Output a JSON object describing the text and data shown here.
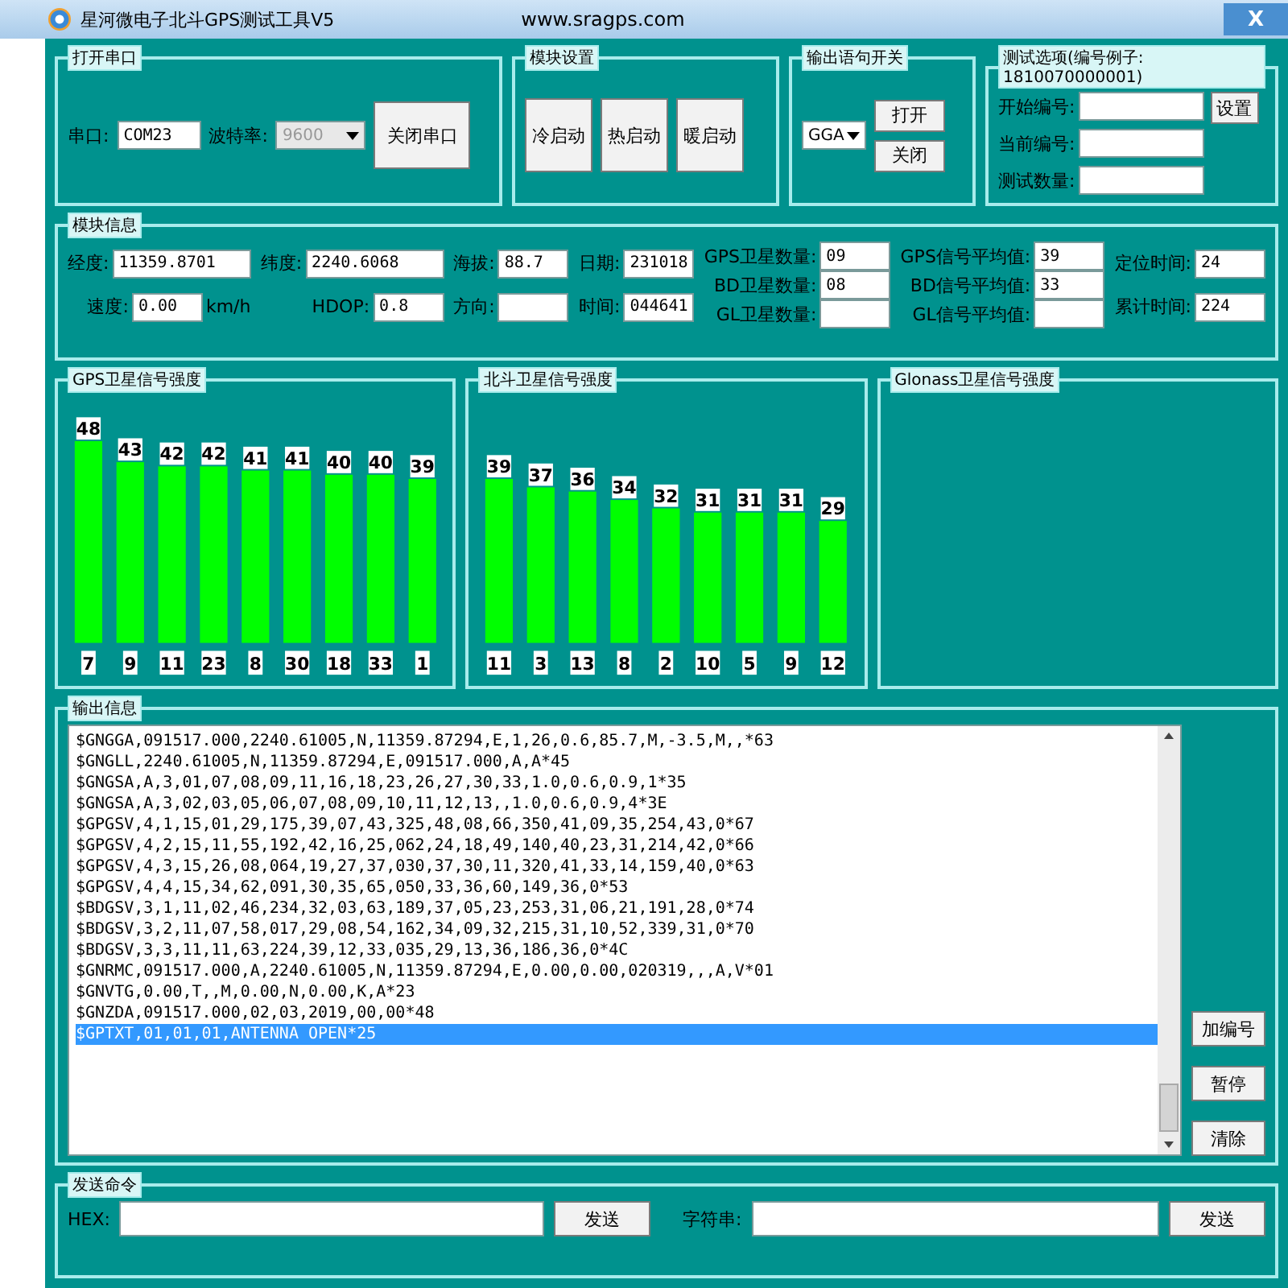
{
  "window": {
    "title": "星河微电子北斗GPS测试工具V5",
    "url": "www.sragps.com",
    "close": "X"
  },
  "serial": {
    "title": "打开串口",
    "port_label": "串口:",
    "port": "COM23",
    "baud_label": "波特率:",
    "baud": "9600",
    "baud_disabled": true,
    "button": "关闭串口"
  },
  "module_settings": {
    "title": "模块设置",
    "buttons": [
      "冷启动",
      "热启动",
      "暖启动"
    ]
  },
  "output_switch": {
    "title": "输出语句开关",
    "sentence": "GGA",
    "buttons": [
      "打开",
      "关闭"
    ]
  },
  "test_options": {
    "title": "测试选项(编号例子: 1810070000001)",
    "fields": [
      {
        "label": "开始编号:"
      },
      {
        "label": "当前编号:"
      },
      {
        "label": "测试数量:"
      }
    ],
    "button": "设置"
  },
  "module_info": {
    "title": "模块信息",
    "columns": [
      [
        {
          "label": "经度:",
          "value": "11359.8701"
        },
        {
          "label": "速度:",
          "value": "0.00",
          "unit": "km/h"
        }
      ],
      [
        {
          "label": "纬度:",
          "value": "2240.6068"
        },
        {
          "label": "HDOP:",
          "value": "0.8"
        }
      ],
      [
        {
          "label": "海拔:",
          "value": "88.7"
        },
        {
          "label": "方向:"
        }
      ],
      [
        {
          "label": "日期:",
          "value": "231018"
        },
        {
          "label": "时间:",
          "value": "044641"
        }
      ],
      [
        {
          "label": "GPS卫星数量:",
          "value": "09"
        },
        {
          "label": "BD卫星数量:",
          "value": "08"
        },
        {
          "label": "GL卫星数量:"
        }
      ],
      [
        {
          "label": "GPS信号平均值:",
          "value": "39"
        },
        {
          "label": "BD信号平均值:",
          "value": "33"
        },
        {
          "label": "GL信号平均值:"
        }
      ],
      [
        {
          "label": "定位时间:",
          "value": "24"
        },
        {
          "label": "累计时间:",
          "value": "224"
        }
      ]
    ]
  },
  "charts": [
    {
      "title": "GPS卫星信号强度",
      "chart_data": {
        "type": "bar",
        "categories": [
          "7",
          "9",
          "11",
          "23",
          "8",
          "30",
          "18",
          "33",
          "1"
        ],
        "values": [
          48,
          43,
          42,
          42,
          41,
          41,
          40,
          40,
          39
        ],
        "data_labels": true
      }
    },
    {
      "title": "北斗卫星信号强度",
      "chart_data": {
        "type": "bar",
        "categories": [
          "11",
          "3",
          "13",
          "8",
          "2",
          "10",
          "5",
          "9",
          "12"
        ],
        "values": [
          39,
          37,
          36,
          34,
          32,
          31,
          31,
          31,
          29
        ],
        "data_labels": true
      }
    },
    {
      "title": "Glonass卫星信号强度"
    }
  ],
  "output": {
    "title": "输出信息",
    "lines": [
      {
        "text": "$GNGGA,091517.000,2240.61005,N,11359.87294,E,1,26,0.6,85.7,M,-3.5,M,,*63",
        "selected": false
      },
      {
        "text": "$GNGLL,2240.61005,N,11359.87294,E,091517.000,A,A*45",
        "selected": false
      },
      {
        "text": "$GNGSA,A,3,01,07,08,09,11,16,18,23,26,27,30,33,1.0,0.6,0.9,1*35",
        "selected": false
      },
      {
        "text": "$GNGSA,A,3,02,03,05,06,07,08,09,10,11,12,13,,1.0,0.6,0.9,4*3E",
        "selected": false
      },
      {
        "text": "$GPGSV,4,1,15,01,29,175,39,07,43,325,48,08,66,350,41,09,35,254,43,0*67",
        "selected": false
      },
      {
        "text": "$GPGSV,4,2,15,11,55,192,42,16,25,062,24,18,49,140,40,23,31,214,42,0*66",
        "selected": false
      },
      {
        "text": "$GPGSV,4,3,15,26,08,064,19,27,37,030,37,30,11,320,41,33,14,159,40,0*63",
        "selected": false
      },
      {
        "text": "$GPGSV,4,4,15,34,62,091,30,35,65,050,33,36,60,149,36,0*53",
        "selected": false
      },
      {
        "text": "$BDGSV,3,1,11,02,46,234,32,03,63,189,37,05,23,253,31,06,21,191,28,0*74",
        "selected": false
      },
      {
        "text": "$BDGSV,3,2,11,07,58,017,29,08,54,162,34,09,32,215,31,10,52,339,31,0*70",
        "selected": false
      },
      {
        "text": "$BDGSV,3,3,11,11,63,224,39,12,33,035,29,13,36,186,36,0*4C",
        "selected": false
      },
      {
        "text": "$GNRMC,091517.000,A,2240.61005,N,11359.87294,E,0.00,0.00,020319,,,A,V*01",
        "selected": false
      },
      {
        "text": "$GNVTG,0.00,T,,M,0.00,N,0.00,K,A*23",
        "selected": false
      },
      {
        "text": "$GNZDA,091517.000,02,03,2019,00,00*48",
        "selected": false
      },
      {
        "text": "$GPTXT,01,01,01,ANTENNA OPEN*25",
        "selected": true
      }
    ],
    "buttons": [
      "加编号",
      "暂停",
      "清除"
    ]
  },
  "send": {
    "title": "发送命令",
    "rows": [
      {
        "label": "HEX:",
        "button": "发送"
      },
      {
        "label": "字符串:",
        "button": "发送"
      }
    ]
  }
}
